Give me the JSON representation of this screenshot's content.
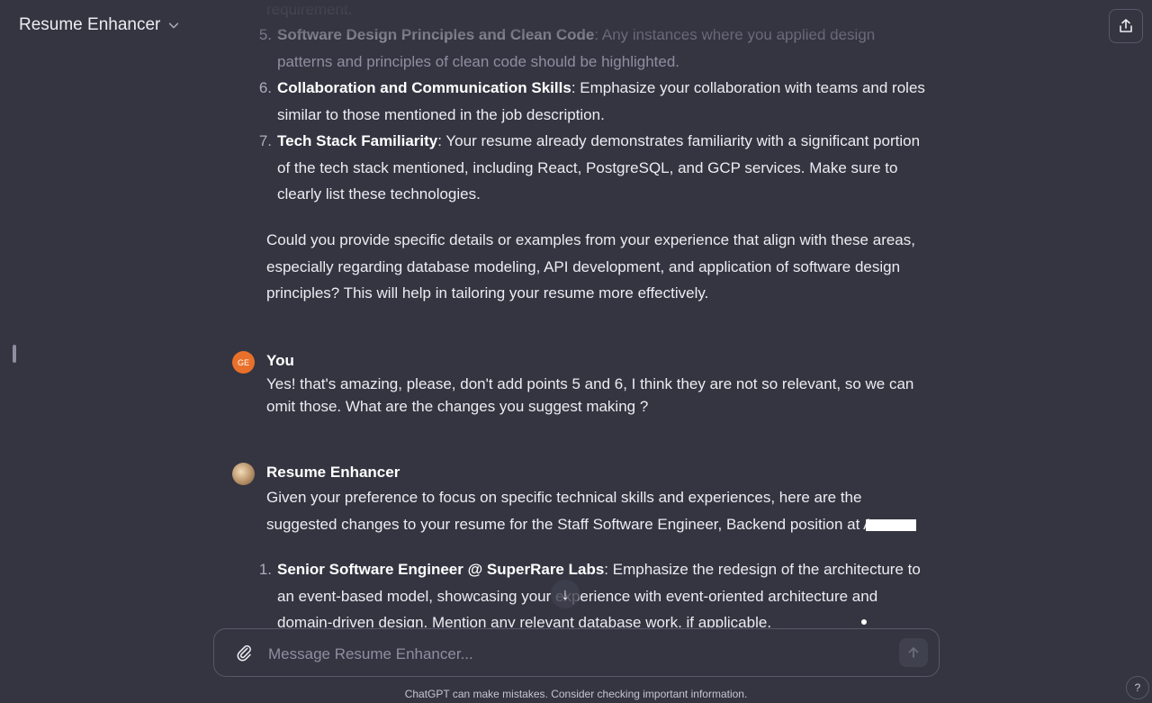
{
  "header": {
    "title": "Resume Enhancer"
  },
  "thread": {
    "top_fragment": "requirement.",
    "list_a": [
      {
        "num": "5.",
        "bold": "Software Design Principles and Clean Code",
        "text": ": Any instances where you applied design patterns and principles of clean code should be highlighted."
      },
      {
        "num": "6.",
        "bold": "Collaboration and Communication Skills",
        "text": ": Emphasize your collaboration with teams and roles similar to those mentioned in the job description."
      },
      {
        "num": "7.",
        "bold": "Tech Stack Familiarity",
        "text": ": Your resume already demonstrates familiarity with a significant portion of the tech stack mentioned, including React, PostgreSQL, and GCP services. Make sure to clearly list these technologies."
      }
    ],
    "closing": "Could you provide specific details or examples from your experience that align with these areas, especially regarding database modeling, API development, and application of software design principles? This will help in tailoring your resume more effectively.",
    "user_msg": {
      "avatar": "GE",
      "author": "You",
      "text": "Yes! that's amazing, please, don't add points 5 and 6, I think they are not so relevant, so we can omit those. What are the changes you suggest making ?"
    },
    "bot_msg": {
      "author": "Resume Enhancer",
      "intro": "Given your preference to focus on specific technical skills and experiences, here are the suggested changes to your resume for the Staff Software Engineer, Backend position at A",
      "list": [
        {
          "num": "1.",
          "bold": "Senior Software Engineer @ SuperRare Labs",
          "text": ": Emphasize the redesign of the architecture to an event-based model, showcasing your experience with event-oriented architecture and domain-driven design. Mention any relevant database work, if applicable."
        }
      ]
    }
  },
  "composer": {
    "placeholder": "Message Resume Enhancer..."
  },
  "footer": {
    "note": "ChatGPT can make mistakes. Consider checking important information.",
    "help": "?"
  },
  "icons": {
    "title_chevron": "chevron-down-icon",
    "share": "share-icon",
    "attach": "paperclip-icon",
    "send": "arrow-up-icon",
    "scroll": "arrow-down-icon"
  }
}
